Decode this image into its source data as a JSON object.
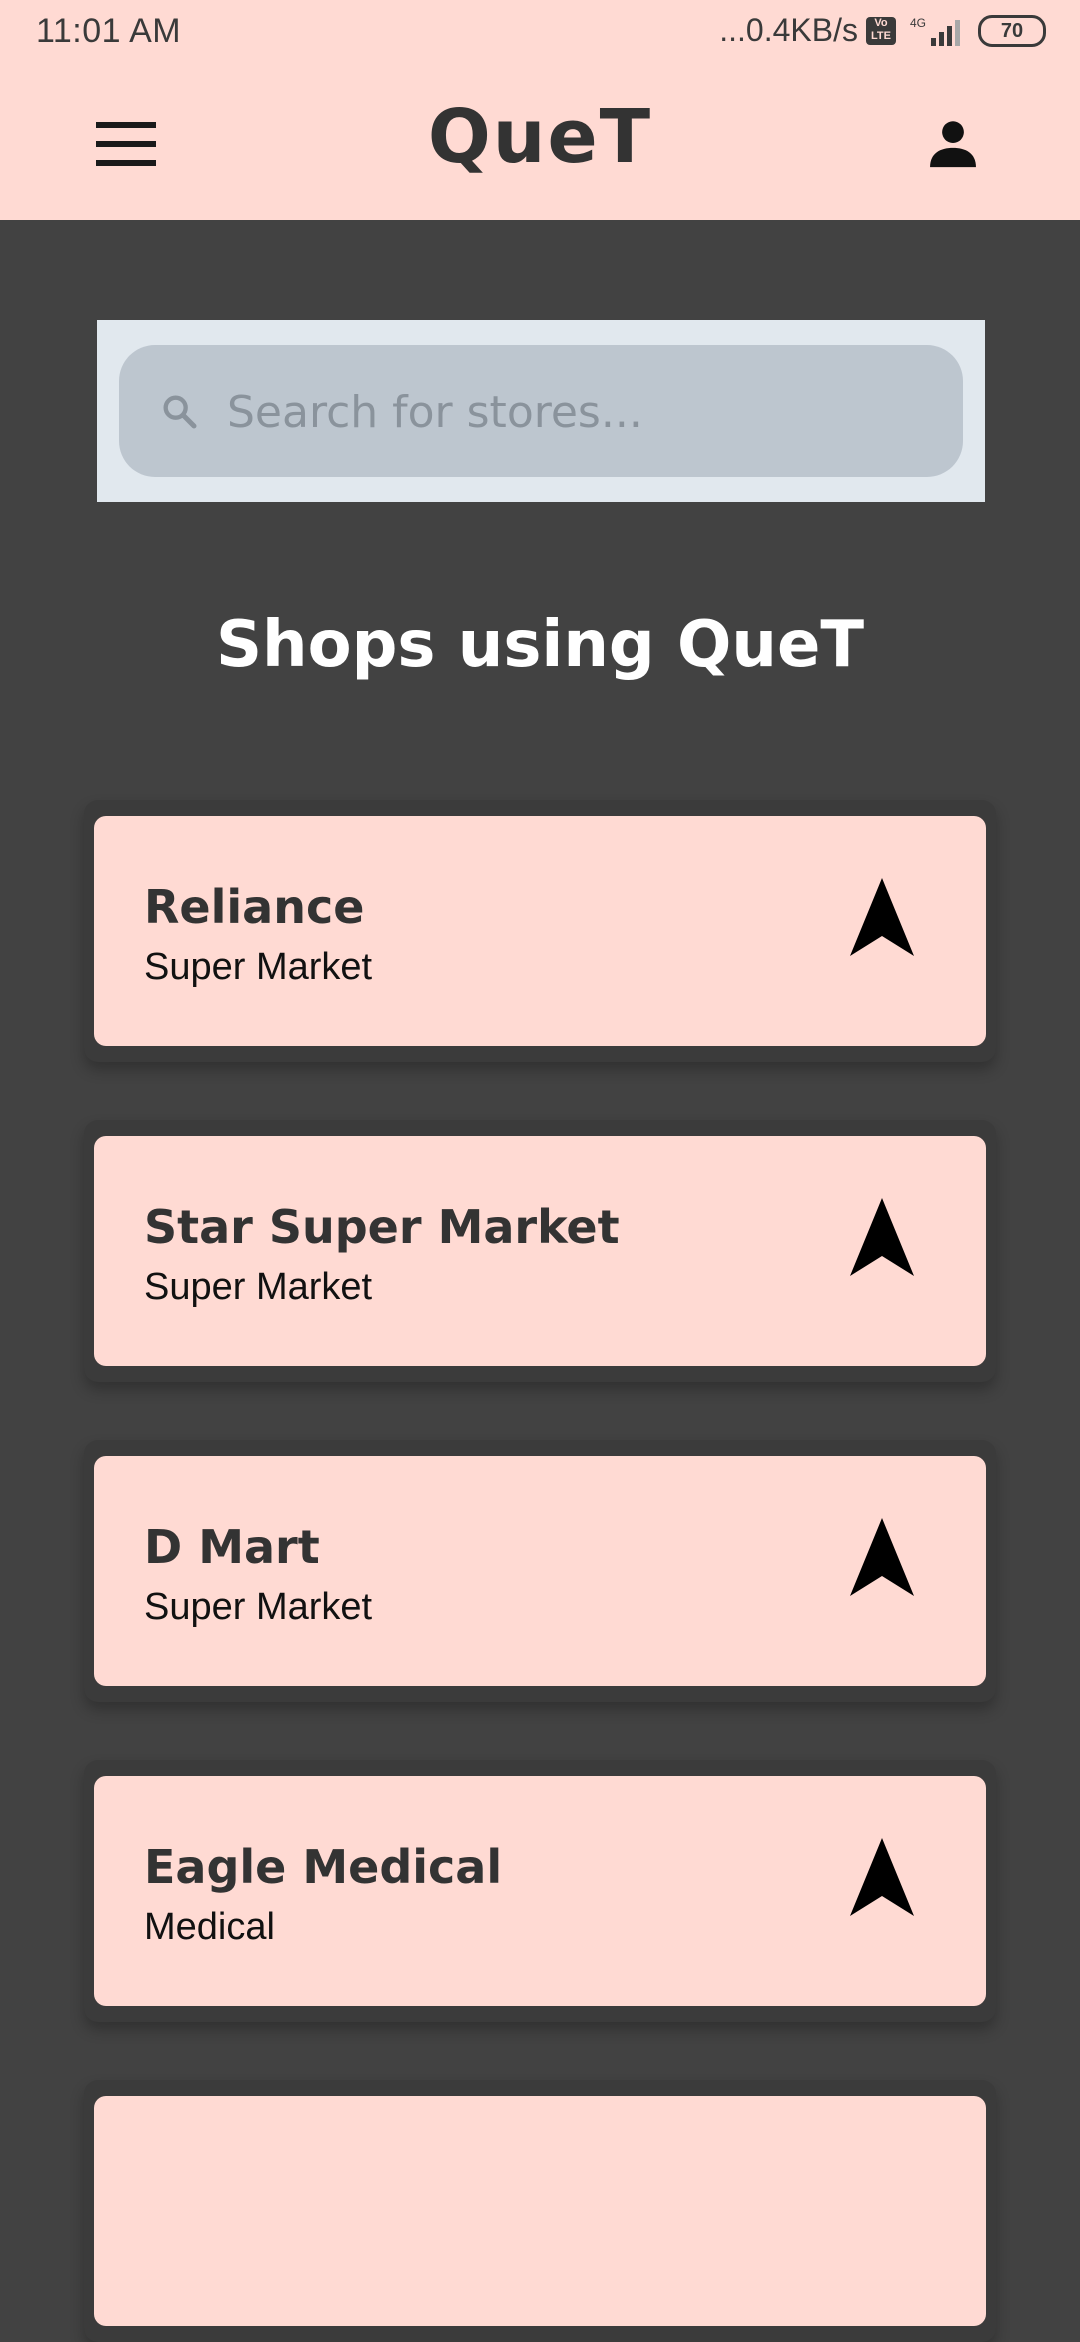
{
  "status_bar": {
    "time": "11:01 AM",
    "network_speed": "...0.4KB/s",
    "volte_label": "Vo LTE",
    "network_type": "4G",
    "battery": "70"
  },
  "app_bar": {
    "title": "QueT",
    "menu_icon": "hamburger-menu-icon",
    "profile_icon": "person-icon"
  },
  "search": {
    "placeholder": "Search for stores...",
    "value": "",
    "icon": "search-icon"
  },
  "section_title": "Shops using QueT",
  "shops": [
    {
      "name": "Reliance",
      "category": "Super Market",
      "icon": "navigation-arrow-icon"
    },
    {
      "name": "Star Super Market",
      "category": "Super Market",
      "icon": "navigation-arrow-icon"
    },
    {
      "name": "D Mart",
      "category": "Super Market",
      "icon": "navigation-arrow-icon"
    },
    {
      "name": "Eagle Medical",
      "category": "Medical",
      "icon": "navigation-arrow-icon"
    },
    {
      "name": "",
      "category": "",
      "icon": ""
    }
  ],
  "colors": {
    "app_bar_bg": "#FFDAD3",
    "content_bg": "#424242",
    "card_bg": "#FFDAD3",
    "search_panel_bg": "#E1E8EE",
    "search_box_bg": "#BDC6CF"
  }
}
